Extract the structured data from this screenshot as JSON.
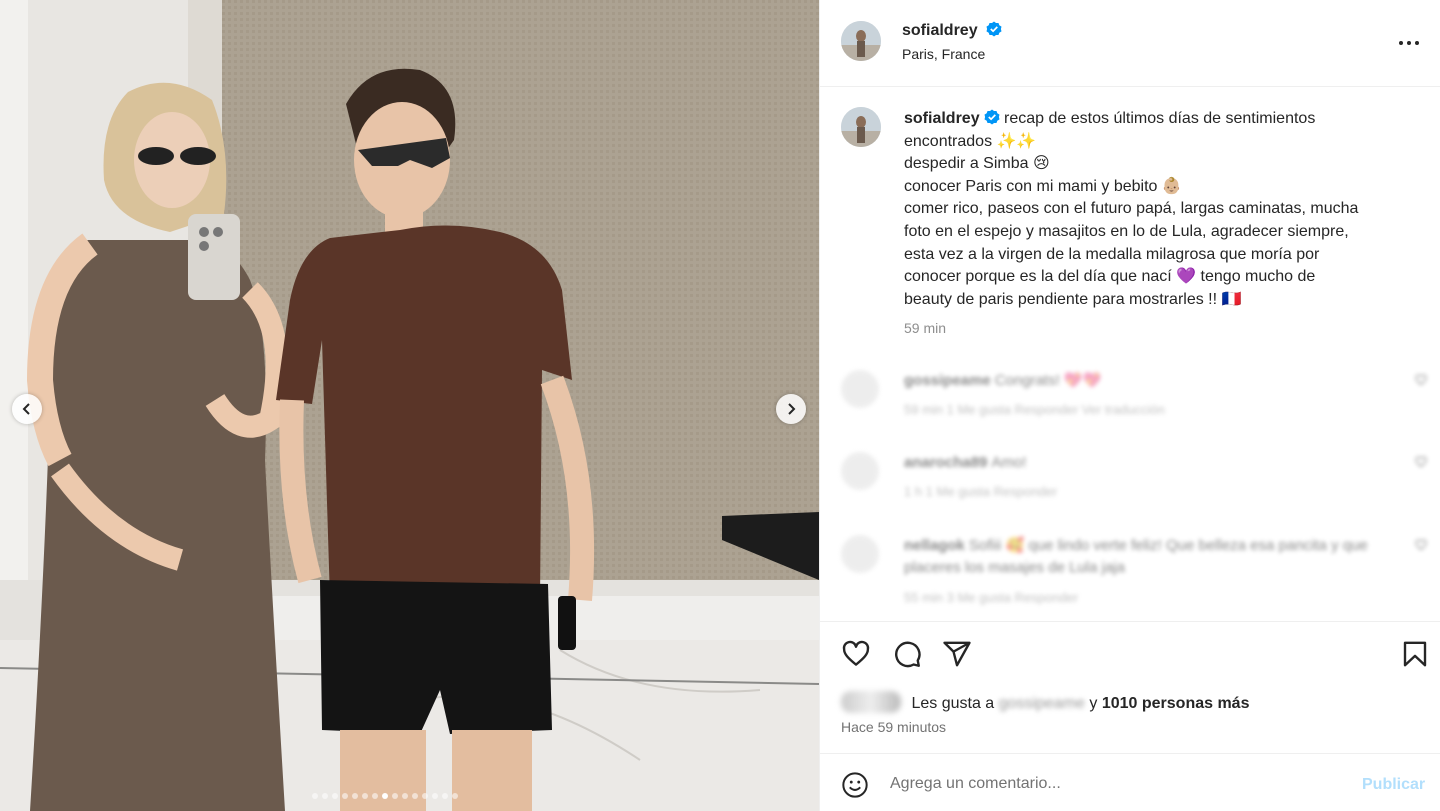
{
  "post": {
    "username": "sofialdrey",
    "location": "Paris, France",
    "verified": true
  },
  "caption": {
    "username": "sofialdrey",
    "lines": [
      "recap de estos últimos días de sentimientos",
      "encontrados ✨✨",
      "despedir a Simba 😢",
      "conocer Paris con mi mami y bebito 👶🏼",
      "comer rico, paseos con el futuro papá, largas caminatas, mucha",
      "foto en el espejo y masajitos en lo de Lula, agradecer siempre,",
      "esta vez a la virgen de la medalla milagrosa que moría por",
      "conocer porque es la del día que nací 💜 tengo mucho de",
      "beauty de paris pendiente para mostrarles !! 🇫🇷"
    ],
    "time": "59 min"
  },
  "comments": [
    {
      "user": "gossipeame",
      "text": "Congrats! 💖💖",
      "meta": "59 min  1 Me gusta  Responder  Ver traducción"
    },
    {
      "user": "anarocha89",
      "text": "Amo!",
      "meta": "1 h  1 Me gusta  Responder"
    },
    {
      "user": "nellagok",
      "text": "Sofiii 🥰 que lindo verte feliz! Que belleza esa pancita y que placeres los masajes de Lula jaja",
      "meta": "55 min  3 Me gusta  Responder"
    }
  ],
  "likes": {
    "prefix": "Les gusta a",
    "blurred_user": "gossipeame",
    "connector": "y",
    "others": "1010 personas más"
  },
  "time_ago": "Hace 59 minutos",
  "comment_box": {
    "placeholder": "Agrega un comentario...",
    "publish_label": "Publicar"
  },
  "carousel": {
    "total": 15,
    "active_index": 7
  },
  "icons": {
    "more": "more-horizontal-icon",
    "like": "heart-icon",
    "comment": "comment-bubble-icon",
    "share": "paper-plane-icon",
    "save": "bookmark-icon",
    "emoji": "smiley-icon",
    "prev": "chevron-left-icon",
    "next": "chevron-right-icon",
    "verified": "verified-badge-icon"
  },
  "colors": {
    "verified_blue": "#0095f6",
    "publish_disabled": "#b2dffc",
    "meta_gray": "#8e8e8e",
    "border": "#efefef"
  }
}
